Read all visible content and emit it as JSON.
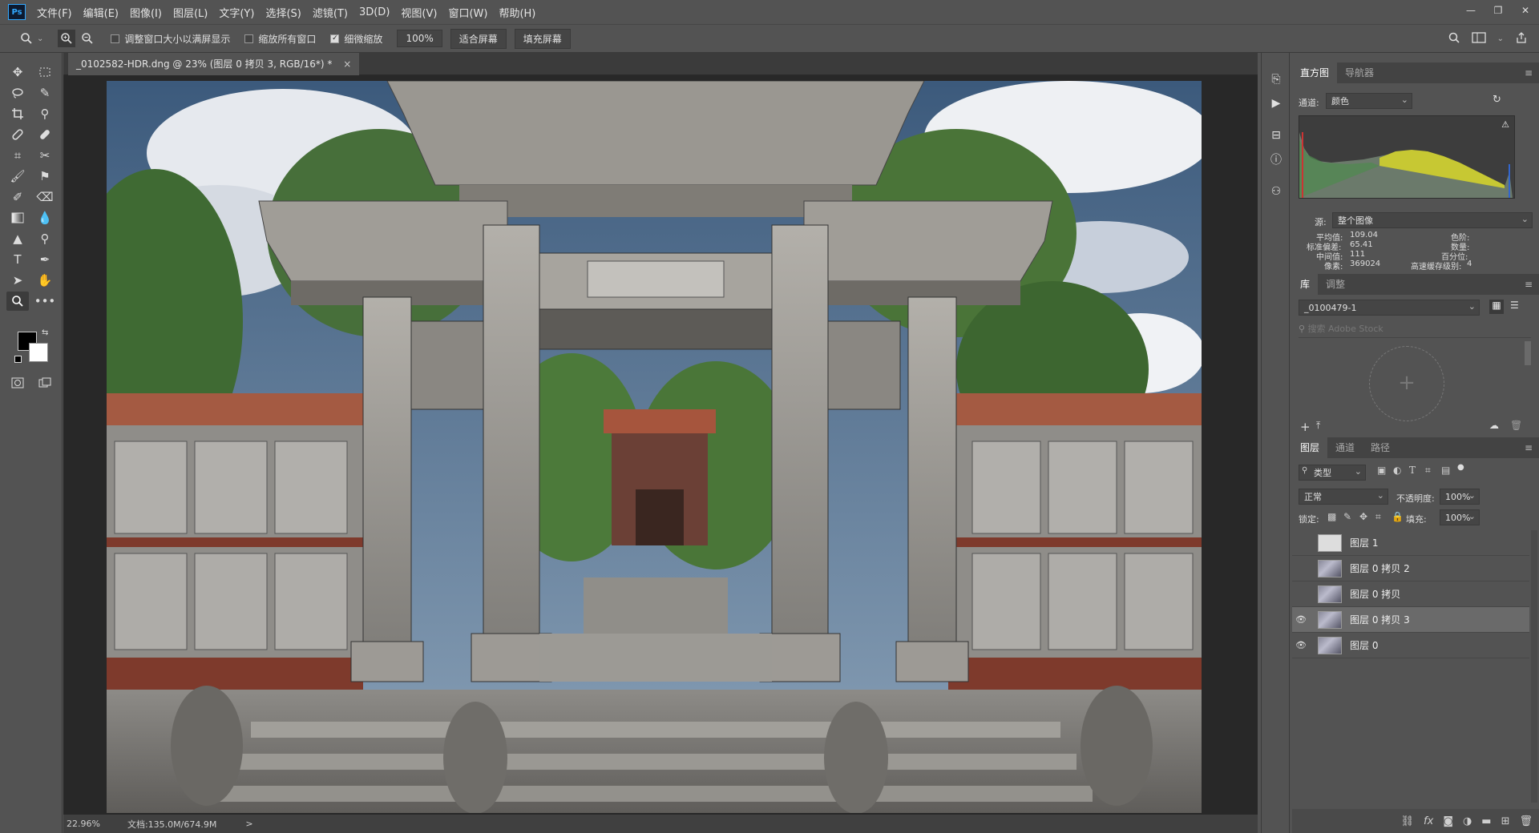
{
  "app": {
    "logo": "Ps"
  },
  "menu": [
    "文件(F)",
    "编辑(E)",
    "图像(I)",
    "图层(L)",
    "文字(Y)",
    "选择(S)",
    "滤镜(T)",
    "3D(D)",
    "视图(V)",
    "窗口(W)",
    "帮助(H)"
  ],
  "window_controls": {
    "minimize": "—",
    "restore": "❐",
    "close": "✕"
  },
  "options": {
    "resize_windows_label": "调整窗口大小以满屏显示",
    "resize_windows_checked": false,
    "zoom_all_label": "缩放所有窗口",
    "zoom_all_checked": false,
    "scrubby_zoom_label": "细微缩放",
    "scrubby_zoom_checked": true,
    "zoom_value": "100%",
    "fit_screen": "适合屏幕",
    "fill_screen": "填充屏幕"
  },
  "document": {
    "tab_title": "_0102582-HDR.dng @ 23% (图层 0 拷贝 3, RGB/16*) *",
    "tab_close": "×",
    "zoom": "22.96%",
    "doc_size": "文档:135.0M/674.9M",
    "status_arrow": ">"
  },
  "colors": {
    "foreground": "#000000",
    "background": "#ffffff",
    "accent": "#31a8ff"
  },
  "histogram_panel": {
    "tabs": [
      "直方图",
      "导航器"
    ],
    "channel_label": "通道:",
    "channel_value": "颜色",
    "source_label": "源:",
    "source_value": "整个图像",
    "stats": {
      "mean_label": "平均值:",
      "mean": "109.04",
      "std_label": "标准偏差:",
      "std": "65.41",
      "median_label": "中间值:",
      "median": "111",
      "pixels_label": "像素:",
      "pixels": "369024",
      "level_label": "色阶:",
      "level": "",
      "count_label": "数量:",
      "count": "",
      "percentile_label": "百分位:",
      "percentile": "",
      "cache_label": "高速缓存级别:",
      "cache": "4"
    }
  },
  "library_panel": {
    "tabs": [
      "库",
      "调整"
    ],
    "library_value": "_0100479-1",
    "search_placeholder": "搜索 Adobe Stock"
  },
  "layers_panel": {
    "tabs": [
      "图层",
      "通道",
      "路径"
    ],
    "filter_value": "类型",
    "blend_mode": "正常",
    "opacity_label": "不透明度:",
    "opacity": "100%",
    "lock_label": "锁定:",
    "fill_label": "填充:",
    "fill": "100%",
    "layers": [
      {
        "name": "图层 1",
        "visible": false,
        "selected": false
      },
      {
        "name": "图层 0 拷贝 2",
        "visible": false,
        "selected": false
      },
      {
        "name": "图层 0 拷贝",
        "visible": false,
        "selected": false
      },
      {
        "name": "图层 0 拷贝 3",
        "visible": true,
        "selected": true
      },
      {
        "name": "图层 0",
        "visible": true,
        "selected": false
      }
    ]
  },
  "icons": [
    "zoom-icon",
    "zoom-in-icon",
    "zoom-out-icon",
    "search-icon",
    "workspace-icon",
    "share-icon",
    "move-icon",
    "marquee-icon",
    "lasso-icon",
    "quick-select-icon",
    "crop-icon",
    "eyedropper-icon",
    "healing-icon",
    "brush-icon",
    "stamp-icon",
    "history-brush-icon",
    "eraser-icon",
    "gradient-icon",
    "blur-icon",
    "dodge-icon",
    "pen-icon",
    "type-icon",
    "path-select-icon",
    "hand-icon",
    "more-icon",
    "quickmask-icon",
    "screen-mode-icon",
    "play-icon",
    "info-icon",
    "history-icon",
    "properties-icon",
    "refresh-icon",
    "warning-icon",
    "eye-icon",
    "link-icon",
    "fx-icon",
    "mask-icon",
    "adjustment-icon",
    "folder-icon",
    "new-layer-icon",
    "trash-icon"
  ]
}
